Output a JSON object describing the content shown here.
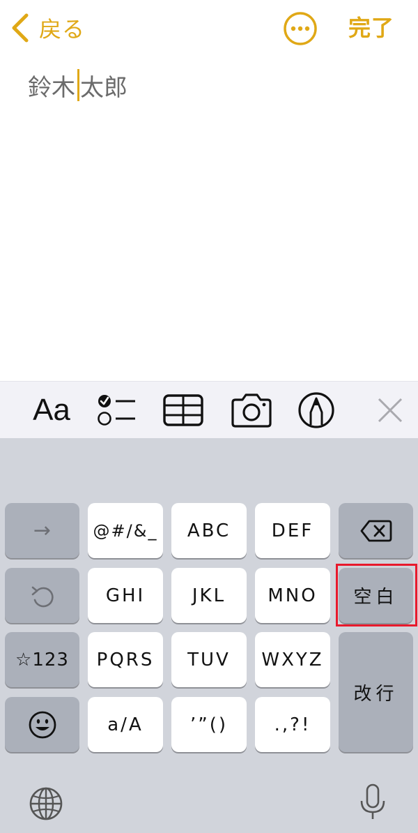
{
  "nav": {
    "back_label": "戻る",
    "done_label": "完了",
    "accent_color": "#E0A816"
  },
  "note": {
    "text_before_caret": "鈴木",
    "text_after_caret": "太郎"
  },
  "toolbar": {
    "format_label": "Aa",
    "icons": [
      "checklist-icon",
      "table-icon",
      "camera-icon",
      "markup-pen-icon",
      "close-icon"
    ]
  },
  "keyboard": {
    "row1": [
      "→",
      "@#/&_",
      "ABC",
      "DEF",
      "delete-icon"
    ],
    "row2": [
      "undo-icon",
      "GHI",
      "JKL",
      "MNO",
      "空白"
    ],
    "row3": [
      "☆123",
      "PQRS",
      "TUV",
      "WXYZ"
    ],
    "row4": [
      "emoji-icon",
      "a/A",
      "’”()",
      ".,?!"
    ],
    "return_label": "改行",
    "highlighted_key": "空白",
    "highlight_color": "#E8192C"
  }
}
